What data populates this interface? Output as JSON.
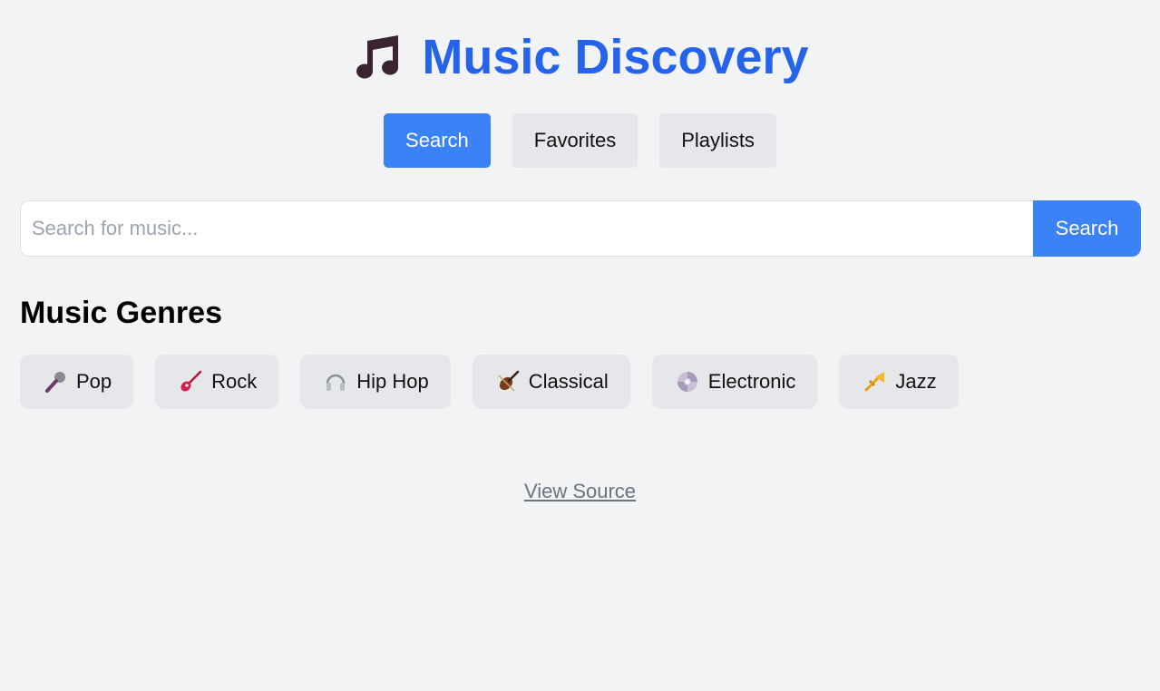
{
  "header": {
    "title": "Music Discovery",
    "logo_icon": "music-note-icon"
  },
  "nav": {
    "tabs": [
      {
        "label": "Search",
        "active": true
      },
      {
        "label": "Favorites",
        "active": false
      },
      {
        "label": "Playlists",
        "active": false
      }
    ]
  },
  "search": {
    "placeholder": "Search for music...",
    "value": "",
    "button_label": "Search"
  },
  "genres": {
    "title": "Music Genres",
    "items": [
      {
        "label": "Pop",
        "icon": "microphone-icon"
      },
      {
        "label": "Rock",
        "icon": "guitar-icon"
      },
      {
        "label": "Hip Hop",
        "icon": "headphones-icon"
      },
      {
        "label": "Classical",
        "icon": "violin-icon"
      },
      {
        "label": "Electronic",
        "icon": "disc-icon"
      },
      {
        "label": "Jazz",
        "icon": "trumpet-icon"
      }
    ]
  },
  "footer": {
    "link_label": "View Source"
  },
  "colors": {
    "accent": "#3b82f6",
    "title": "#2563eb",
    "background": "#f2f3f5",
    "button_bg": "#e5e7eb"
  }
}
